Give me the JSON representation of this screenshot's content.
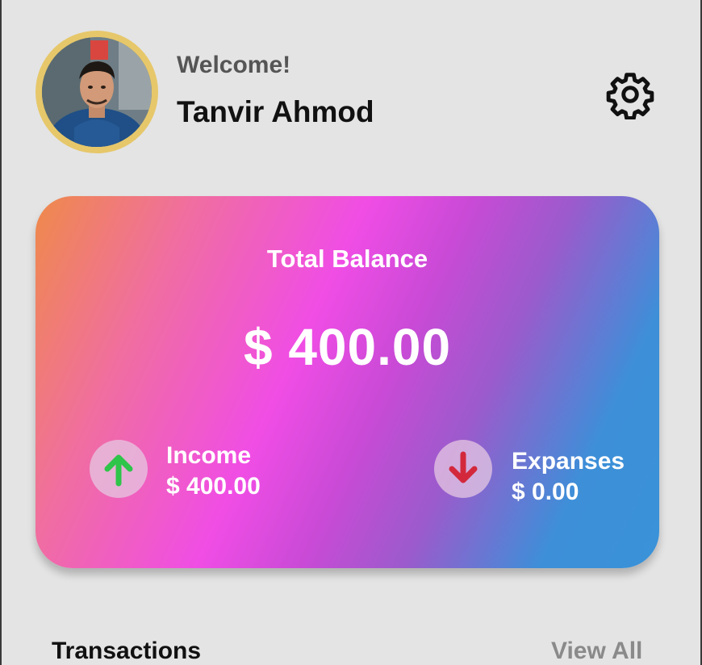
{
  "header": {
    "welcome": "Welcome!",
    "user_name": "Tanvir Ahmod",
    "settings_icon": "gear-icon",
    "avatar_ring_color": "#e6c76a"
  },
  "balance_card": {
    "label": "Total Balance",
    "amount": "$ 400.00",
    "income": {
      "icon": "arrow-up-icon",
      "icon_color": "#2fc44a",
      "label": "Income",
      "value": "$ 400.00"
    },
    "expense": {
      "icon": "arrow-down-icon",
      "icon_color": "#d3283c",
      "label": "Expanses",
      "value": "$ 0.00"
    }
  },
  "transactions": {
    "title": "Transactions",
    "view_all": "View All"
  }
}
